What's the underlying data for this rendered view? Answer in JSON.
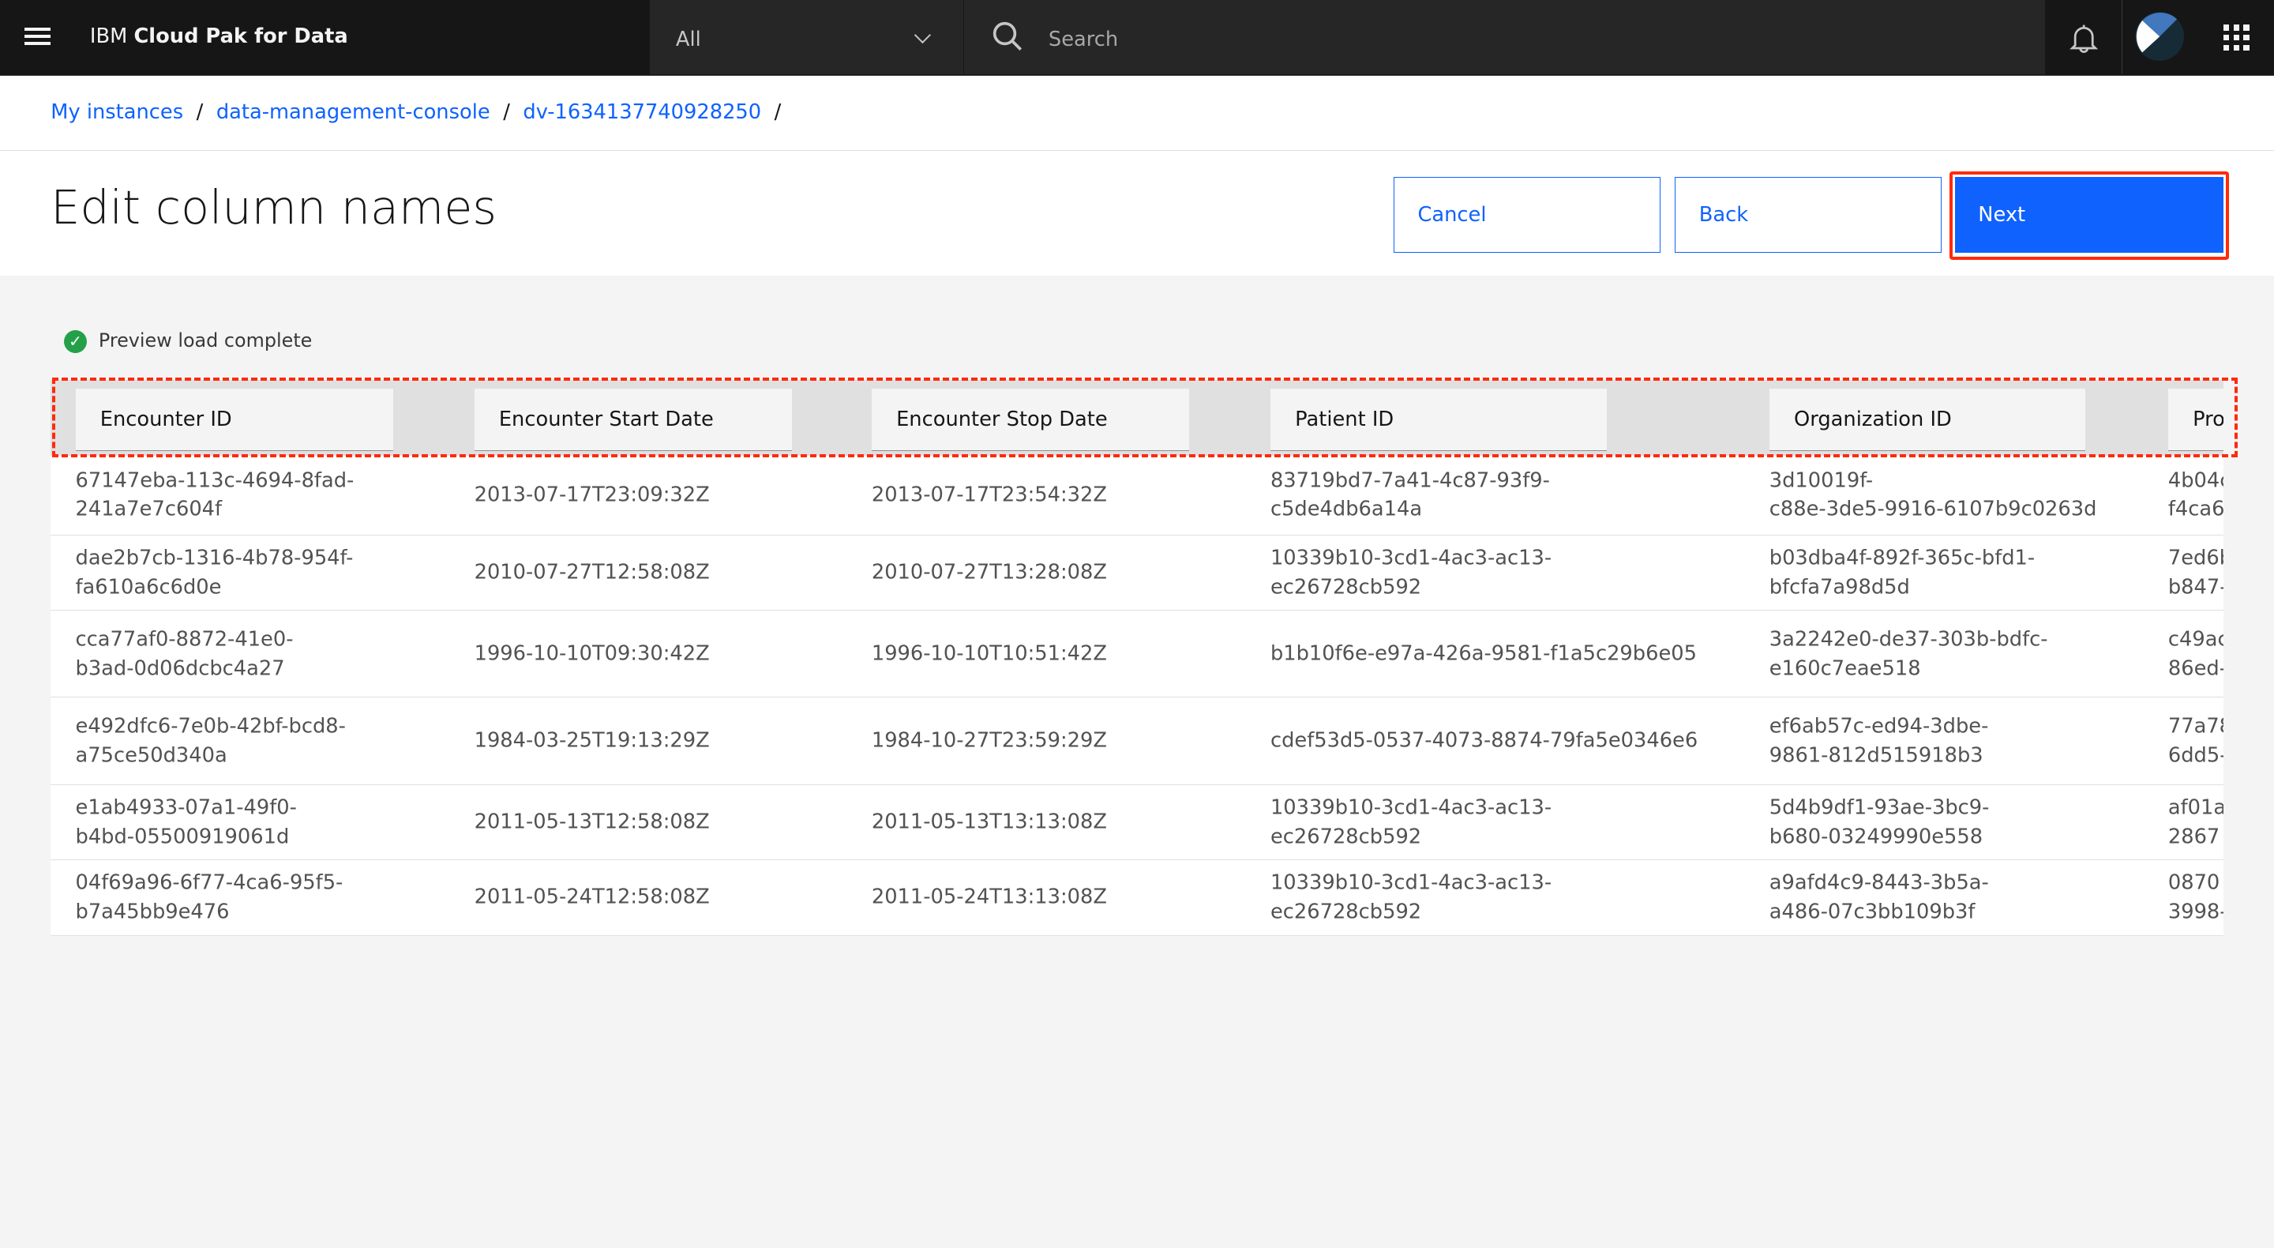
{
  "header": {
    "brand_prefix": "IBM",
    "brand_name": "Cloud Pak for Data",
    "scope_selected": "All",
    "search_placeholder": "Search",
    "icons": [
      "menu-icon",
      "chevron-down-icon",
      "search-icon",
      "notification-bell-icon",
      "avatar",
      "app-switcher-icon"
    ]
  },
  "breadcrumb": [
    {
      "label": "My instances"
    },
    {
      "label": "data-management-console"
    },
    {
      "label": "dv-1634137740928250"
    }
  ],
  "breadcrumb_separator": "/",
  "page": {
    "title": "Edit column names",
    "cancel_label": "Cancel",
    "back_label": "Back",
    "next_label": "Next",
    "status_text": "Preview load complete"
  },
  "colors": {
    "primary": "#0f62fe",
    "success": "#24a148",
    "annotation": "#ff2a0c",
    "topbar": "#161616"
  },
  "table": {
    "columns": [
      "Encounter ID",
      "Encounter Start Date",
      "Encounter Stop Date",
      "Patient ID",
      "Organization ID",
      "Pro"
    ],
    "rows": [
      [
        "67147eba-113c-4694-8fad-\n241a7e7c604f",
        "2013-07-17T23:09:32Z",
        "2013-07-17T23:54:32Z",
        "83719bd7-7a41-4c87-93f9-\nc5de4db6a14a",
        "3d10019f-\nc88e-3de5-9916-6107b9c0263d",
        "4b04c\nf4ca6"
      ],
      [
        "dae2b7cb-1316-4b78-954f-\nfa610a6c6d0e",
        "2010-07-27T12:58:08Z",
        "2010-07-27T13:28:08Z",
        "10339b10-3cd1-4ac3-ac13-\nec26728cb592",
        "b03dba4f-892f-365c-bfd1-\nbfcfa7a98d5d",
        "7ed6b\nb847-"
      ],
      [
        "cca77af0-8872-41e0-\nb3ad-0d06dcbc4a27",
        "1996-10-10T09:30:42Z",
        "1996-10-10T10:51:42Z",
        "b1b10f6e-e97a-426a-9581-f1a5c29b6e05",
        "3a2242e0-de37-303b-bdfc-\ne160c7eae518",
        "c49ac\n86ed-"
      ],
      [
        "e492dfc6-7e0b-42bf-bcd8-\na75ce50d340a",
        "1984-03-25T19:13:29Z",
        "1984-10-27T23:59:29Z",
        "cdef53d5-0537-4073-8874-79fa5e0346e6",
        "ef6ab57c-ed94-3dbe-\n9861-812d515918b3",
        "77a78\n6dd5-"
      ],
      [
        "e1ab4933-07a1-49f0-\nb4bd-05500919061d",
        "2011-05-13T12:58:08Z",
        "2011-05-13T13:13:08Z",
        "10339b10-3cd1-4ac3-ac13-\nec26728cb592",
        "5d4b9df1-93ae-3bc9-\nb680-03249990e558",
        "af01a\n2867"
      ],
      [
        "04f69a96-6f77-4ca6-95f5-\nb7a45bb9e476",
        "2011-05-24T12:58:08Z",
        "2011-05-24T13:13:08Z",
        "10339b10-3cd1-4ac3-ac13-\nec26728cb592",
        "a9afd4c9-8443-3b5a-\na486-07c3bb109b3f",
        "0870\n3998-"
      ]
    ]
  }
}
